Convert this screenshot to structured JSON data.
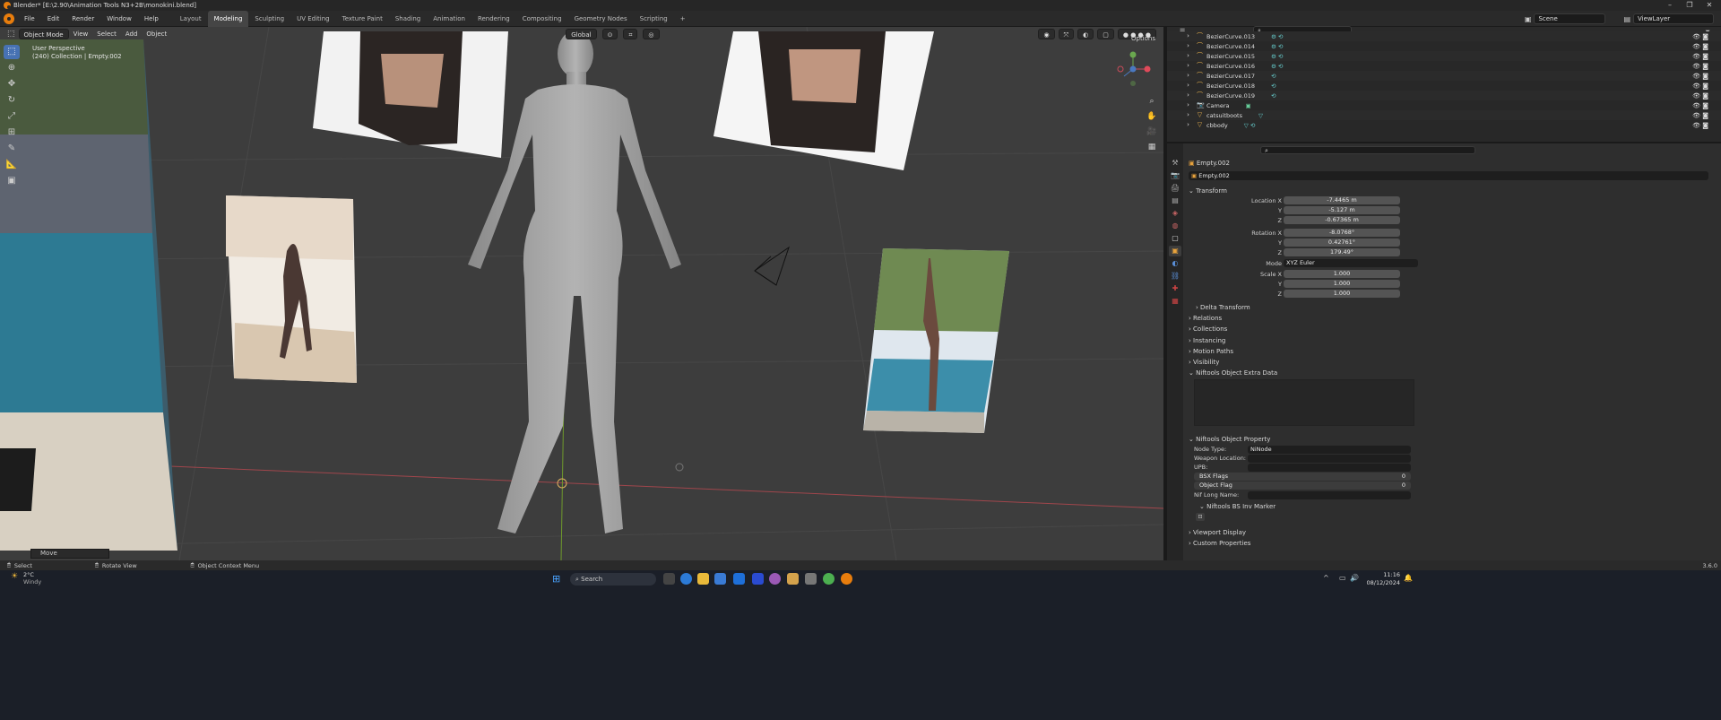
{
  "window": {
    "title": "Blender* [E:\\2.90\\Animation Tools N3+2B\\monokini.blend]"
  },
  "menus": [
    "File",
    "Edit",
    "Render",
    "Window",
    "Help"
  ],
  "workspaces": [
    "Layout",
    "Modeling",
    "Sculpting",
    "UV Editing",
    "Texture Paint",
    "Shading",
    "Animation",
    "Rendering",
    "Compositing",
    "Geometry Nodes",
    "Scripting",
    "+"
  ],
  "active_workspace": "Modeling",
  "top_right": {
    "scene": "Scene",
    "view_layer": "ViewLayer"
  },
  "viewport": {
    "mode": "Object Mode",
    "menus": [
      "View",
      "Select",
      "Add",
      "Object"
    ],
    "orientation": "Global",
    "options": "Options",
    "info_line1": "User Perspective",
    "info_line2": "(240) Collection | Empty.002",
    "last_op": "Move"
  },
  "outliner": {
    "items": [
      {
        "name": "BezierCurve.013",
        "icon": "curve-icon"
      },
      {
        "name": "BezierCurve.014",
        "icon": "curve-icon"
      },
      {
        "name": "BezierCurve.015",
        "icon": "curve-icon"
      },
      {
        "name": "BezierCurve.016",
        "icon": "curve-icon"
      },
      {
        "name": "BezierCurve.017",
        "icon": "curve-icon"
      },
      {
        "name": "BezierCurve.018",
        "icon": "curve-icon"
      },
      {
        "name": "BezierCurve.019",
        "icon": "curve-icon"
      },
      {
        "name": "Camera",
        "icon": "camera-icon"
      },
      {
        "name": "catsuitboots",
        "icon": "mesh-icon"
      },
      {
        "name": "cbbody",
        "icon": "mesh-icon"
      }
    ]
  },
  "properties": {
    "object_name": "Empty.002",
    "object_field": "Empty.002",
    "transform": {
      "title": "Transform",
      "location_label": "Location X",
      "location": [
        "-7.4465 m",
        "-5.127 m",
        "-0.67365 m"
      ],
      "rotation_label": "Rotation X",
      "rotation": [
        "-8.0768°",
        "0.42761°",
        "179.49°"
      ],
      "mode_label": "Mode",
      "mode": "XYZ Euler",
      "scale_label": "Scale X",
      "scale": [
        "1.000",
        "1.000",
        "1.000"
      ],
      "y": "Y",
      "z": "Z"
    },
    "sections": [
      "Delta Transform",
      "Relations",
      "Collections",
      "Instancing",
      "Motion Paths",
      "Visibility",
      "Niftools Object Extra Data"
    ],
    "nif_prop": {
      "title": "Niftools Object Property",
      "node_type_label": "Node Type:",
      "node_type": "NiNode",
      "weapon_label": "Weapon Location:",
      "upb_label": "UPB:",
      "bsx_label": "BSX Flags",
      "bsx": "0",
      "objflag_label": "Object Flag",
      "objflag": "0",
      "longname_label": "Nif Long Name:",
      "bs_inv": "Niftools BS Inv Marker"
    },
    "sections_bottom": [
      "Viewport Display",
      "Custom Properties"
    ]
  },
  "statusbar": {
    "select": "Select",
    "rotate": "Rotate View",
    "context": "Object Context Menu",
    "version": "3.6.0"
  },
  "taskbar": {
    "weather_temp": "2°C",
    "weather_desc": "Windy",
    "search": "Search",
    "time": "11:16",
    "date": "08/12/2024"
  }
}
